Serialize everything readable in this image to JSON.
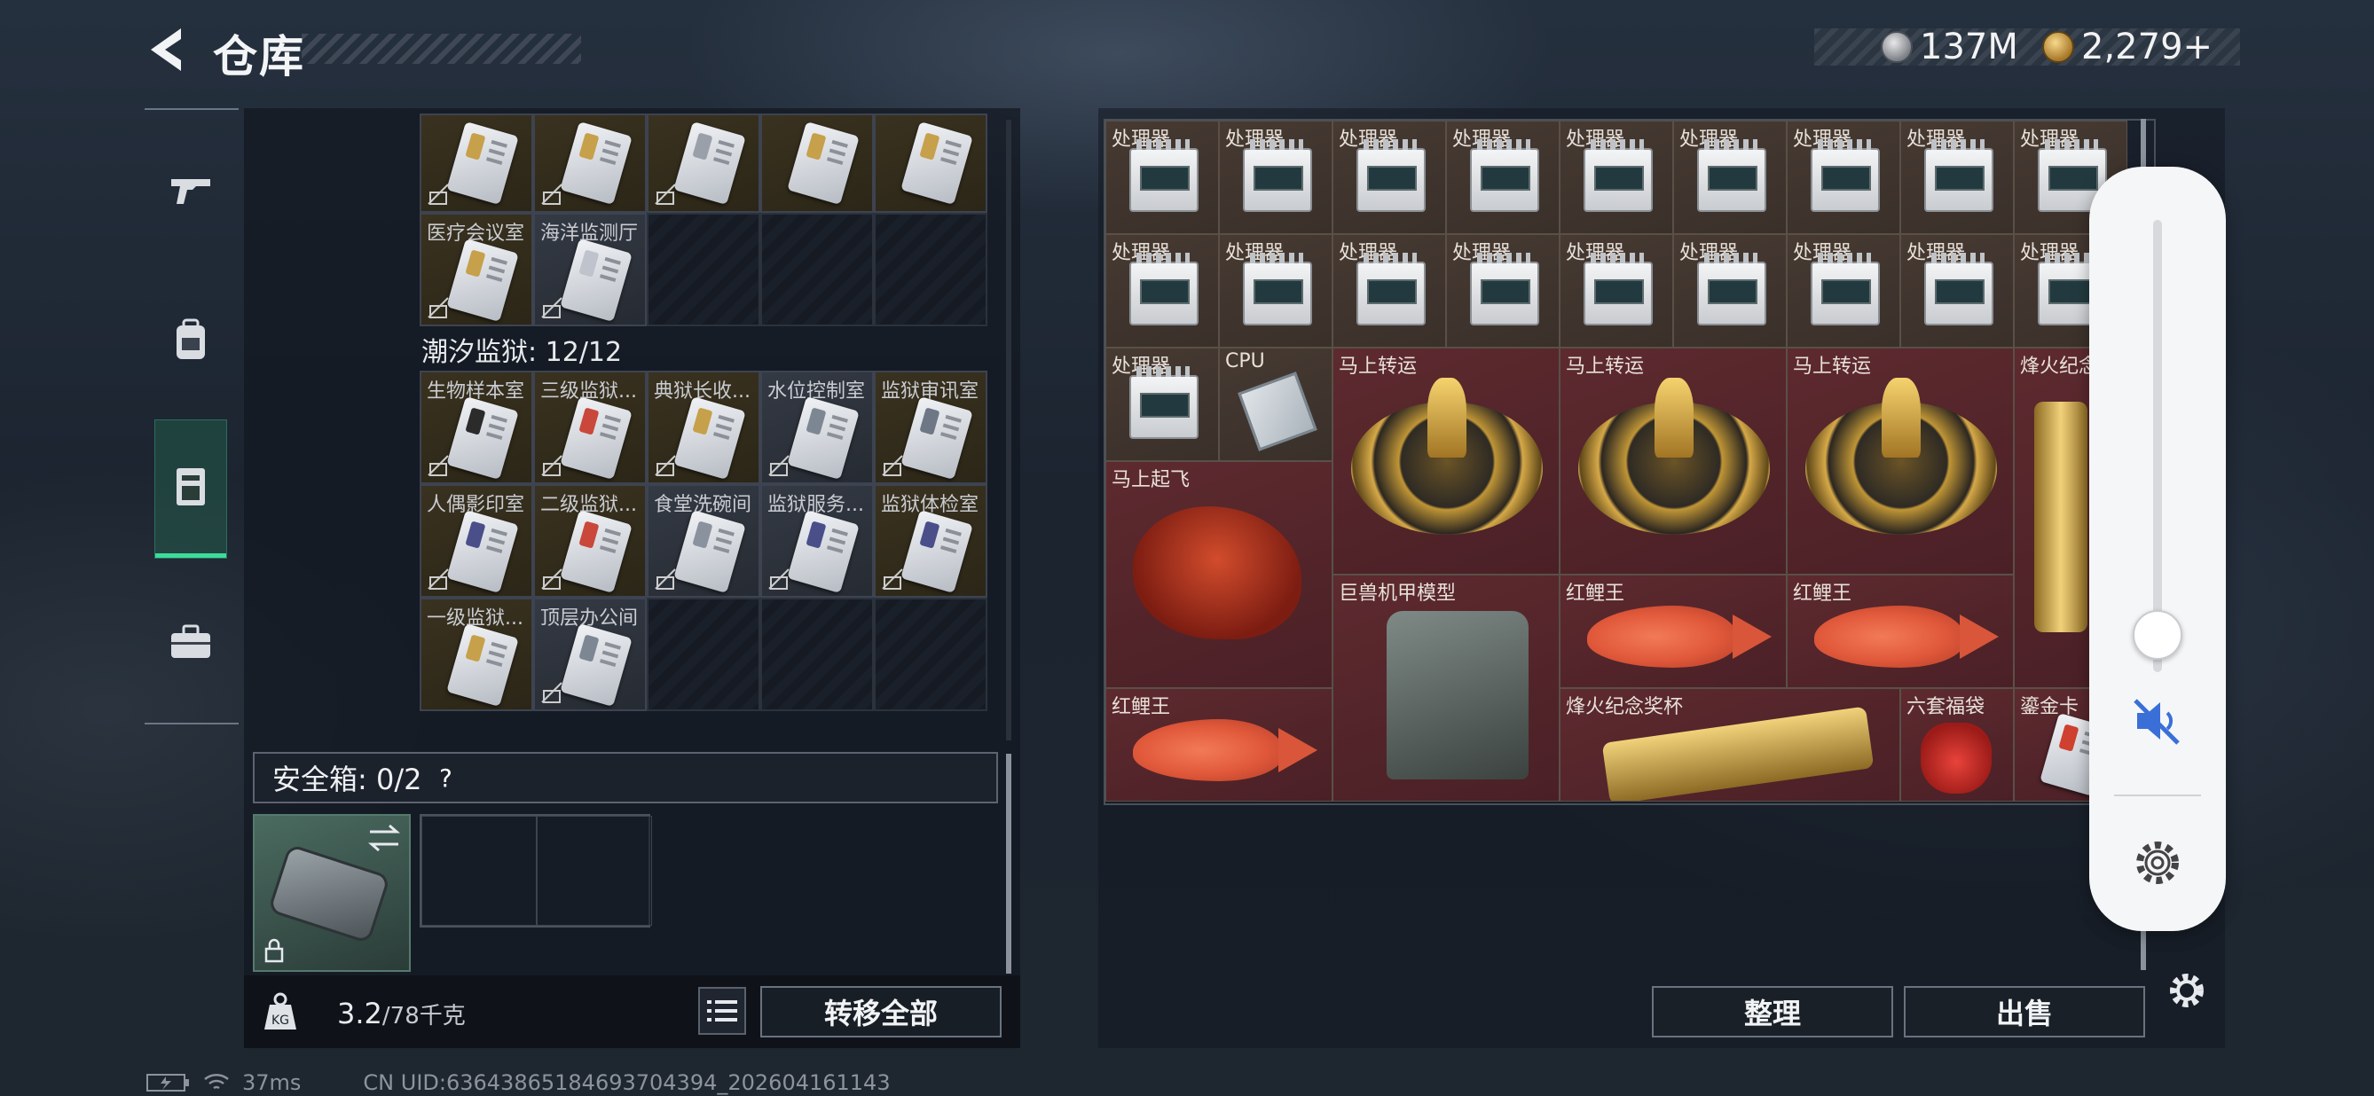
{
  "header": {
    "title": "仓库"
  },
  "currency": {
    "silver": "137M",
    "gold": "2,279+"
  },
  "sidenav": {
    "items": [
      {
        "name": "weapon",
        "icon": "gun-icon"
      },
      {
        "name": "equipment",
        "icon": "backpack-icon"
      },
      {
        "name": "locker",
        "icon": "locker-icon",
        "active": true
      },
      {
        "name": "briefcase",
        "icon": "briefcase-icon"
      }
    ]
  },
  "keycards": {
    "top_row": [
      "",
      "",
      "",
      "",
      ""
    ],
    "row2": [
      "医疗会议室",
      "海洋监测厅"
    ],
    "section_title": "潮汐监狱: 12/12",
    "prison": [
      [
        "生物样本室",
        "三级监狱...",
        "典狱长收...",
        "水位控制室",
        "监狱审讯室"
      ],
      [
        "人偶影印室",
        "二级监狱...",
        "食堂洗碗间",
        "监狱服务...",
        "监狱体检室"
      ],
      [
        "一级监狱...",
        "顶层办公间"
      ]
    ]
  },
  "safebox": {
    "label": "安全箱: 0/2",
    "help": "?"
  },
  "weight": {
    "value": "3.2",
    "unit": "/78千克"
  },
  "buttons": {
    "transfer_all": "转移全部",
    "sort": "整理",
    "sell": "出售"
  },
  "stash": {
    "processor_label": "处理器",
    "cpu_label": "CPU",
    "lucky_label": "马上转运",
    "fly_label": "马上起飞",
    "beacon_label": "烽火纪念",
    "mech_label": "巨兽机甲模型",
    "carp_label": "红鲤王",
    "trophy_label": "烽火纪念奖杯",
    "bag_label": "六套福袋",
    "gold_label": "鎏金卡"
  },
  "statusbar": {
    "ping": "37ms",
    "uid": "CN UID:63643865184693704394_202604161143"
  }
}
